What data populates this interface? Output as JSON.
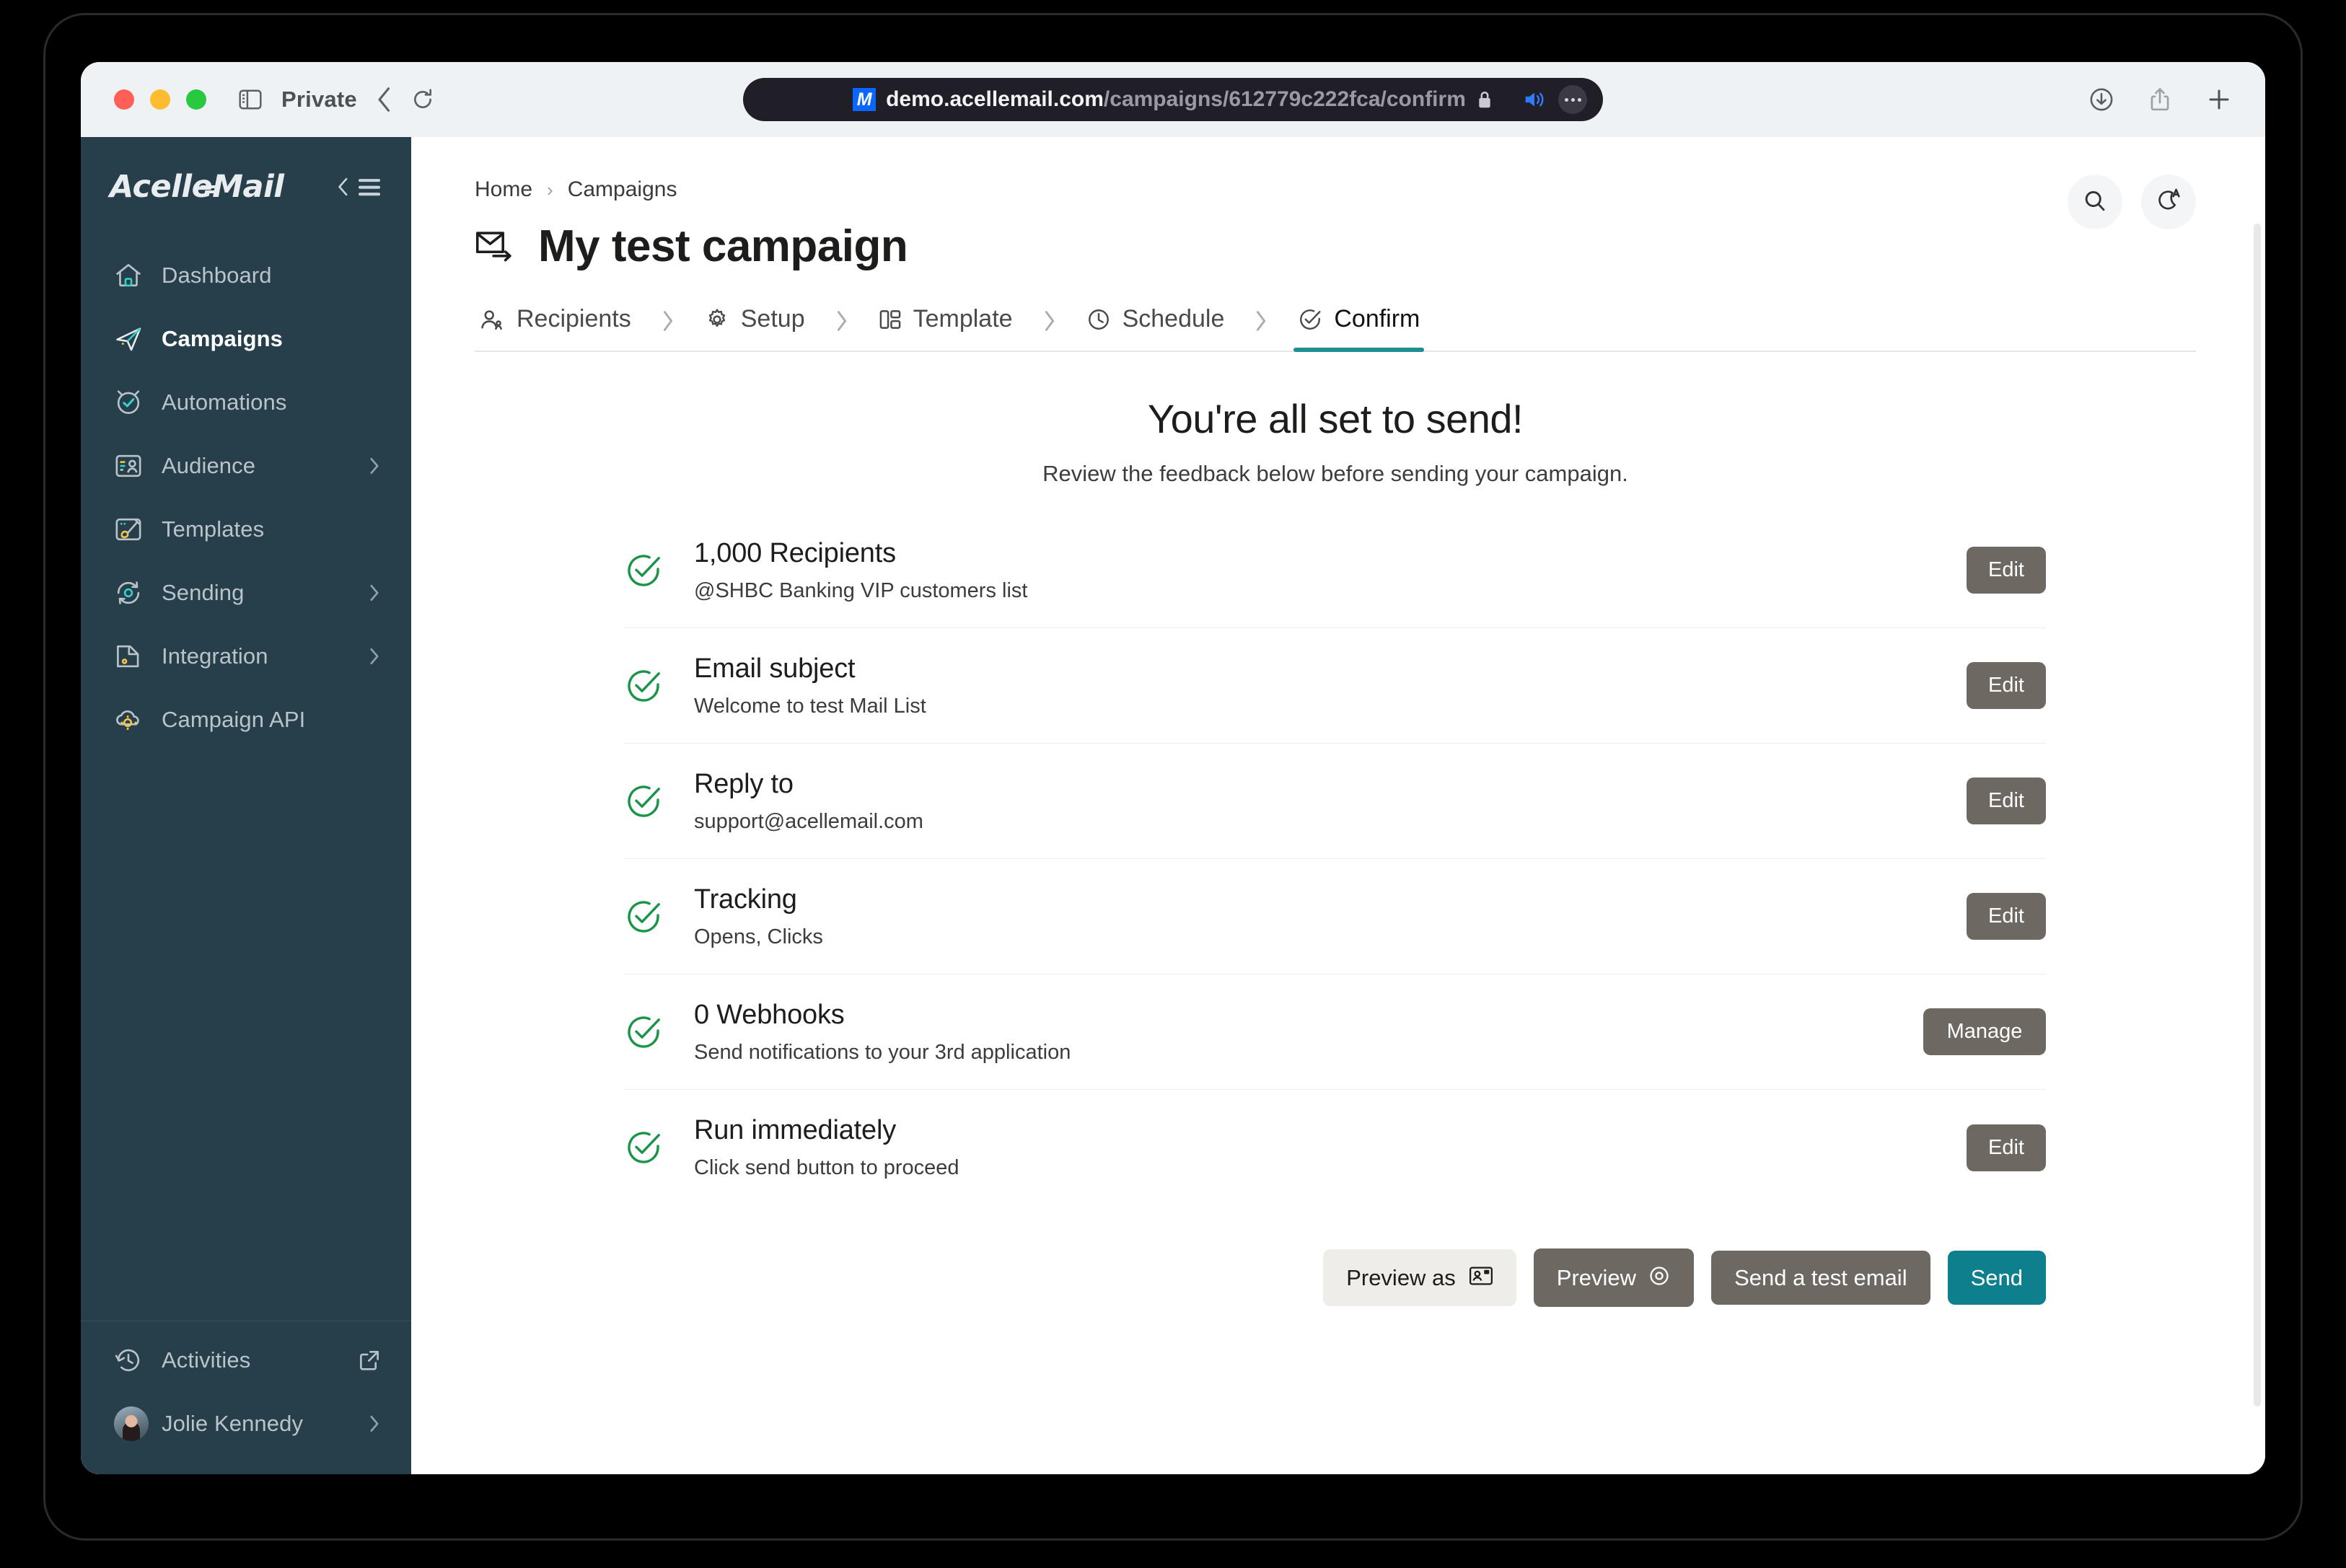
{
  "browser": {
    "privacy_label": "Private",
    "url_host": "demo.acellemail.com",
    "url_path": "/campaigns/612779c222fca/confirm",
    "icons": {
      "sidebar_toggle": "sidebar-toggle-icon",
      "back": "back-chevron-icon",
      "reload": "reload-icon",
      "lock": "lock-icon",
      "audio": "speaker-icon",
      "more": "more-options-icon",
      "downloads": "download-icon",
      "share": "share-icon",
      "new_tab": "plus-icon"
    },
    "favicon_letter": "M"
  },
  "sidebar": {
    "logo": {
      "part1": "Acelle",
      "part2": "Mail"
    },
    "collapse_label": "collapse-sidebar",
    "items": [
      {
        "label": "Dashboard",
        "icon": "home-icon",
        "active": false,
        "chevron": false
      },
      {
        "label": "Campaigns",
        "icon": "paper-plane-icon",
        "active": true,
        "chevron": false
      },
      {
        "label": "Automations",
        "icon": "clock-check-icon",
        "active": false,
        "chevron": false
      },
      {
        "label": "Audience",
        "icon": "contact-list-icon",
        "active": false,
        "chevron": true
      },
      {
        "label": "Templates",
        "icon": "paint-brush-icon",
        "active": false,
        "chevron": false
      },
      {
        "label": "Sending",
        "icon": "sync-gear-icon",
        "active": false,
        "chevron": true
      },
      {
        "label": "Integration",
        "icon": "plug-save-icon",
        "active": false,
        "chevron": true
      },
      {
        "label": "Campaign API",
        "icon": "api-gear-icon",
        "active": false,
        "chevron": false
      }
    ],
    "bottom": {
      "activities": {
        "label": "Activities",
        "icon": "history-clock-icon",
        "action_icon": "external-link-icon"
      },
      "user": {
        "name": "Jolie Kennedy",
        "avatar": "user-avatar",
        "chevron": true
      }
    }
  },
  "header": {
    "breadcrumb": [
      {
        "label": "Home"
      },
      {
        "label": "Campaigns"
      }
    ],
    "breadcrumb_separator": "›",
    "title": "My test campaign",
    "title_icon": "envelope-send-icon",
    "search_icon": "search-icon",
    "theme_icon": "moon-auto-icon"
  },
  "steps": [
    {
      "label": "Recipients",
      "icon": "people-icon",
      "active": false
    },
    {
      "label": "Setup",
      "icon": "gear-icon",
      "active": false
    },
    {
      "label": "Template",
      "icon": "layout-icon",
      "active": false
    },
    {
      "label": "Schedule",
      "icon": "clock-icon",
      "active": false
    },
    {
      "label": "Confirm",
      "icon": "check-circle-icon",
      "active": true
    }
  ],
  "step_separator": "›",
  "hero": {
    "heading": "You're all set to send!",
    "subheading": "Review the feedback below before sending your campaign."
  },
  "checklist": [
    {
      "title": "1,000 Recipients",
      "subtitle": "@SHBC Banking VIP customers list",
      "action": "Edit",
      "status_icon": "check-circle-green-icon"
    },
    {
      "title": "Email subject",
      "subtitle": "Welcome to test Mail List",
      "action": "Edit",
      "status_icon": "check-circle-green-icon"
    },
    {
      "title": "Reply to",
      "subtitle": "support@acellemail.com",
      "action": "Edit",
      "status_icon": "check-circle-green-icon"
    },
    {
      "title": "Tracking",
      "subtitle": "Opens, Clicks",
      "action": "Edit",
      "status_icon": "check-circle-green-icon"
    },
    {
      "title": "0 Webhooks",
      "subtitle": "Send notifications to your 3rd application",
      "action": "Manage",
      "status_icon": "check-circle-green-icon"
    },
    {
      "title": "Run immediately",
      "subtitle": "Click send button to proceed",
      "action": "Edit",
      "status_icon": "check-circle-green-icon"
    }
  ],
  "footer_buttons": {
    "preview_as": "Preview as",
    "preview_as_icon": "contact-card-icon",
    "preview": "Preview",
    "preview_icon": "eye-icon",
    "send_test": "Send a test email",
    "send": "Send"
  },
  "colors": {
    "sidebar_bg": "#273e4b",
    "accent_teal": "#0e7f8c",
    "button_gray": "#6e6862",
    "check_green": "#1a9448",
    "active_underline": "#1f8f91"
  }
}
